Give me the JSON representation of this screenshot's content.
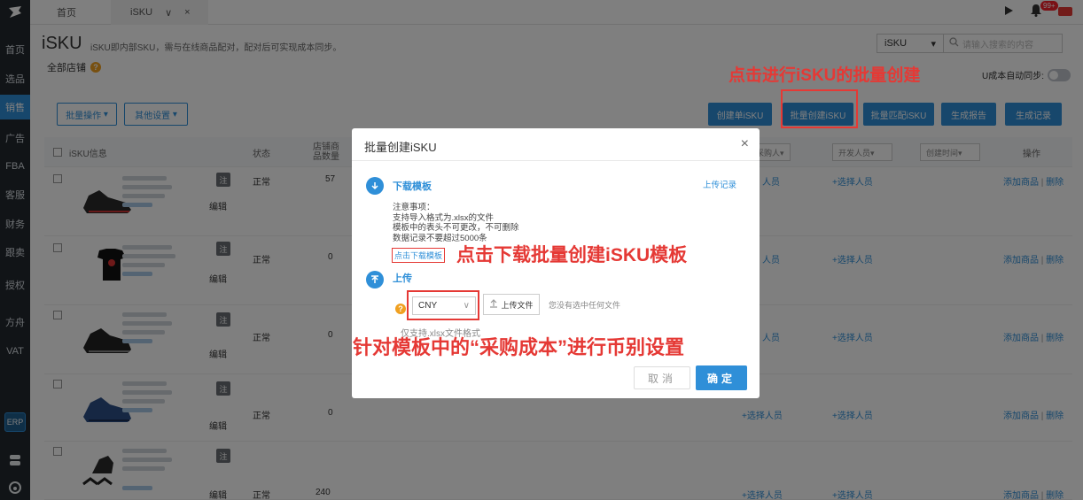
{
  "sidebar": {
    "logo": "logo",
    "items": [
      {
        "label": "首页",
        "active": false
      },
      {
        "label": "选品",
        "active": false
      },
      {
        "label": "销售",
        "active": true
      },
      {
        "label": "广告",
        "active": false
      },
      {
        "label": "FBA",
        "active": false
      },
      {
        "label": "客服",
        "active": false
      },
      {
        "label": "财务",
        "active": false
      },
      {
        "label": "跟卖",
        "active": false
      },
      {
        "label": "授权",
        "active": false
      },
      {
        "label": "方舟",
        "active": false
      },
      {
        "label": "VAT",
        "active": false
      }
    ],
    "erp": "ERP"
  },
  "topbar": {
    "tabs": [
      {
        "label": "首页"
      },
      {
        "label": "iSKU"
      }
    ],
    "tab_close": "×",
    "tab_chevron": "∨",
    "notification_badge": "99+"
  },
  "page": {
    "title": "iSKU",
    "subtitle": "iSKU即内部SKU，需与在线商品配对，配对后可实现成本同步。",
    "shop_filter": "全部店铺",
    "search_select": "iSKU",
    "search_placeholder": "请输入搜索的内容",
    "auto_sync_label": "U成本自动同步:",
    "buttons": {
      "batch_ops": "批量操作",
      "other_settings": "其他设置",
      "create_single": "创建单iSKU",
      "batch_create": "批量创建iSKU",
      "batch_match": "批量匹配iSKU",
      "gen_report": "生成报告",
      "gen_record": "生成记录"
    }
  },
  "table": {
    "headers": {
      "info": "iSKU信息",
      "status": "状态",
      "shop_count": "店铺商\n品数量",
      "buyer": "采购人▾",
      "developer": "开发人员▾",
      "created": "创建时间▾",
      "ops": "操作"
    },
    "rows": [
      {
        "status": "正常",
        "count": "57",
        "buyer": "人员",
        "developer": "+选择人员",
        "ops_add": "添加商品",
        "ops_sep": "|",
        "ops_del": "删除",
        "tag": "注",
        "edit": "编辑"
      },
      {
        "status": "正常",
        "count": "0",
        "buyer": "人员",
        "developer": "+选择人员",
        "ops_add": "添加商品",
        "ops_sep": "|",
        "ops_del": "删除",
        "tag": "注",
        "edit": "编辑"
      },
      {
        "status": "正常",
        "count": "0",
        "buyer": "人员",
        "developer": "+选择人员",
        "ops_add": "添加商品",
        "ops_sep": "|",
        "ops_del": "删除",
        "tag": "注",
        "edit": "编辑"
      },
      {
        "status": "正常",
        "count": "0",
        "buyer": "+选择人员",
        "developer": "+选择人员",
        "ops_add": "添加商品",
        "ops_sep": "|",
        "ops_del": "删除",
        "tag": "注",
        "edit": "编辑"
      },
      {
        "status": "正常",
        "count": "240",
        "buyer": "+选择人员",
        "developer": "+选择人员",
        "ops_add": "添加商品",
        "ops_sep": "|",
        "ops_del": "删除",
        "tag": "注",
        "edit": "编辑"
      }
    ]
  },
  "modal": {
    "title": "批量创建iSKU",
    "close": "×",
    "step1_title": "下载模板",
    "upload_record": "上传记录",
    "notes": [
      "注意事项：",
      "支持导入格式为.xlsx的文件",
      "模板中的表头不可更改，不可删除",
      "数据记录不要超过5000条"
    ],
    "download_link": "点击下载模板",
    "step2_title": "上传",
    "currency": "CNY",
    "upload_button": "上传文件",
    "no_file": "您没有选中任何文件",
    "only_xlsx": "仅支持.xlsx文件格式",
    "cancel": "取消",
    "confirm": "确定"
  },
  "annotations": {
    "batch_create": "点击进行iSKU的批量创建",
    "download_template": "点击下载批量创建iSKU模板",
    "currency_setting": "针对模板中的“采购成本”进行币别设置"
  },
  "colors": {
    "primary": "#2f8fd8",
    "sidebar": "#23292e",
    "annotation": "#e53935"
  }
}
